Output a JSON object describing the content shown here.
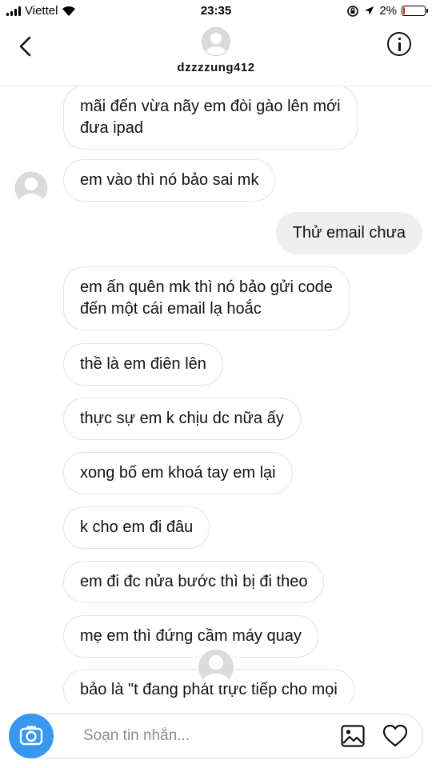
{
  "status_bar": {
    "carrier": "Viettel",
    "time": "23:35",
    "battery": "2%",
    "battery_level": 0.02
  },
  "header": {
    "username": "dzzzzung412"
  },
  "messages": [
    {
      "side": "in",
      "lines": [
        "mãi đến vừa nãy em đòi gào lên mới",
        "đưa ipad"
      ]
    },
    {
      "side": "in",
      "lines": [
        "em vào thì nó bảo sai mk"
      ],
      "avatar": true
    },
    {
      "side": "out",
      "lines": [
        "Thử email chưa"
      ]
    },
    {
      "side": "in",
      "lines": [
        "em ấn quên mk thì nó bảo gửi code",
        "đến một cái email lạ hoắc"
      ]
    },
    {
      "side": "in",
      "lines": [
        "thề là em điên lên"
      ]
    },
    {
      "side": "in",
      "lines": [
        "thực sự em k chịu dc nữa ấy"
      ]
    },
    {
      "side": "in",
      "lines": [
        "xong bố em khoá tay em lại"
      ]
    },
    {
      "side": "in",
      "lines": [
        "k cho em đi đâu"
      ]
    },
    {
      "side": "in",
      "lines": [
        "em đi đc nửa bước thì bị đi theo"
      ]
    },
    {
      "side": "in",
      "lines": [
        "mẹ em thì đứng cầm máy quay"
      ]
    },
    {
      "side": "in",
      "lines": [
        "bảo là \"t đang phát trực tiếp cho mọi"
      ]
    }
  ],
  "composer": {
    "placeholder": "Soạn tin nhắn..."
  },
  "colors": {
    "camera": "#3897f0",
    "incoming_border": "#e3e3e3",
    "outgoing_bg": "#efefef"
  }
}
